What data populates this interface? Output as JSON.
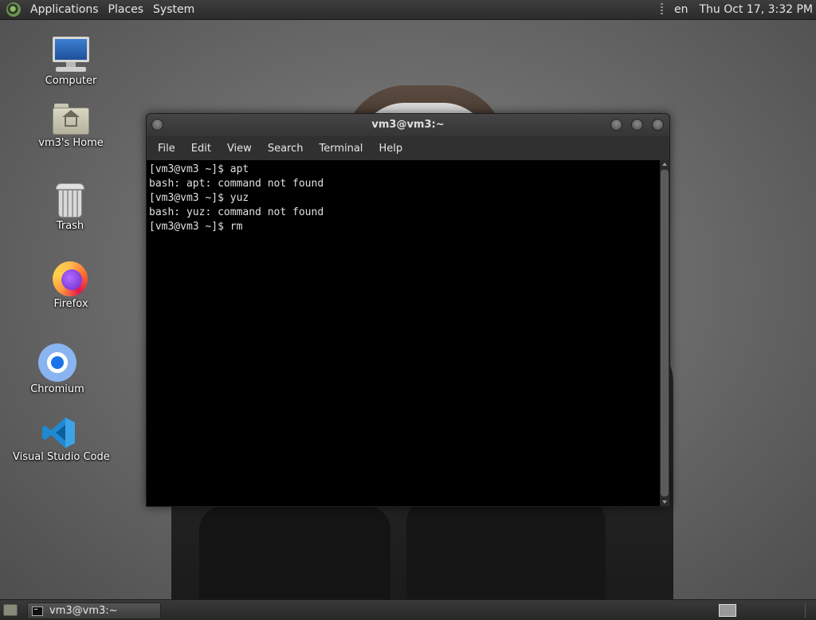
{
  "top_panel": {
    "menus": [
      "Applications",
      "Places",
      "System"
    ],
    "language": "en",
    "clock": "Thu Oct 17,  3:32 PM"
  },
  "desktop_icons": [
    {
      "label": "Computer",
      "icon": "computer-icon"
    },
    {
      "label": "vm3's Home",
      "icon": "home-folder-icon"
    },
    {
      "label": "Trash",
      "icon": "trash-icon"
    },
    {
      "label": "Firefox",
      "icon": "firefox-icon"
    },
    {
      "label": "Chromium",
      "icon": "chromium-icon"
    },
    {
      "label": "Visual Studio Code",
      "icon": "vscode-icon"
    }
  ],
  "terminal": {
    "title": "vm3@vm3:~",
    "menu": [
      "File",
      "Edit",
      "View",
      "Search",
      "Terminal",
      "Help"
    ],
    "lines": [
      "[vm3@vm3 ~]$ apt",
      "bash: apt: command not found",
      "[vm3@vm3 ~]$ yuz",
      "bash: yuz: command not found",
      "[vm3@vm3 ~]$ rm"
    ]
  },
  "bottom_panel": {
    "task_label": "vm3@vm3:~"
  }
}
